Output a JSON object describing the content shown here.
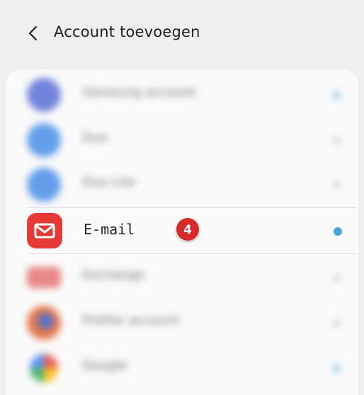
{
  "header": {
    "title": "Account toevoegen",
    "back_icon": "chevron-left-icon"
  },
  "accounts": [
    {
      "label": "Samsung account",
      "icon": "samsung-account-icon",
      "icon_color": "#5b6fd8",
      "dot_color": "#7ec3e6",
      "blurred": true
    },
    {
      "label": "Duo",
      "icon": "duo-icon",
      "icon_color": "#4a8fe8",
      "dot_color": "#cfcfcf",
      "blurred": true
    },
    {
      "label": "Duo Lite",
      "icon": "duo-lite-icon",
      "icon_color": "#4a8fe8",
      "dot_color": "#cfcfcf",
      "blurred": true
    },
    {
      "label": "E-mail",
      "icon": "email-envelope-icon",
      "icon_color": "#e53935",
      "dot_color": "#4aa8d8",
      "blurred": false,
      "badge": "4"
    },
    {
      "label": "Exchange",
      "icon": "exchange-icon",
      "icon_color": "#e57373",
      "dot_color": "#cfcfcf",
      "blurred": true
    },
    {
      "label": "Firefox account",
      "icon": "firefox-icon",
      "icon_color": "#e0612d",
      "dot_color": "#cfcfcf",
      "blurred": true
    },
    {
      "label": "Google",
      "icon": "google-icon",
      "icon_color": "#4285f4",
      "dot_color": "#7ec3e6",
      "blurred": true
    }
  ]
}
